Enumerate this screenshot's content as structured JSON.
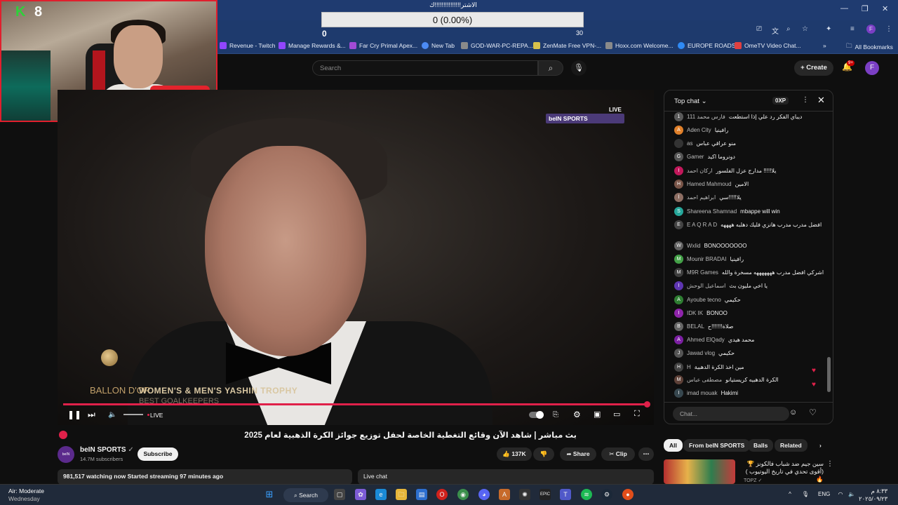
{
  "poll": {
    "title": "الاشتر!!!!!!!!!!!!!!!ك",
    "value": "0 (0.00%)",
    "min": "0",
    "max": "30"
  },
  "webcam": {
    "overlay": "8"
  },
  "bookmarks": [
    {
      "label": "Revenue - Twitch",
      "color": "#9146ff"
    },
    {
      "label": "Manage Rewards &...",
      "color": "#9146ff"
    },
    {
      "label": "Far Cry Primal Apex...",
      "color": "#a24bd6"
    },
    {
      "label": "New Tab",
      "color": "#4c8bf5"
    },
    {
      "label": "GOD-WAR-PC-REPA...",
      "color": "#8a8a8a"
    },
    {
      "label": "ZenMate Free VPN-...",
      "color": "#d6c04b"
    },
    {
      "label": "Hoxx.com Welcome...",
      "color": "#8a8a8a"
    },
    {
      "label": "EUROPE ROADS",
      "color": "#2f8af5"
    },
    {
      "label": "OmeTV Video Chat...",
      "color": "#e04040"
    }
  ],
  "all_bookmarks": "All Bookmarks",
  "youtube": {
    "search_placeholder": "Search",
    "create_label": "Create",
    "notif_badge": "9+",
    "avatar_letter": "F"
  },
  "player": {
    "channel_logo": "beIN SPORTS",
    "corner_live": "LIVE",
    "ballon_text": "BALLON D'OR",
    "trophy_line": "WOMEN'S & MEN'S YASHIN TROPHY",
    "trophy_sub": "BEST GOALKEEPERS",
    "live_label": "LIVE"
  },
  "video": {
    "title": "بث مباشر | شاهد الآن وقائع التغطية الخاصة لحفل توزيع جوائز الكرة الذهبية لعام 2025",
    "channel": "beIN SPORTS",
    "channel_avatar": "beIN",
    "subscribers": "14.7M subscribers",
    "subscribe_label": "Subscribe",
    "likes": "137K",
    "share_label": "Share",
    "clip_label": "Clip",
    "watching": "981,517 watching now  Started streaming 97 minutes ago",
    "live_chat_label": "Live chat"
  },
  "chat": {
    "title": "Top chat",
    "points": "0XP",
    "input_placeholder": "Chat...",
    "messages": [
      {
        "author": "111 فارس محمد",
        "text": "ديباي الفكر رد علي إذا استطعت",
        "color": "#5a5a5a",
        "initial": "1"
      },
      {
        "author": "Aden City",
        "text": "رافينيا",
        "color": "#e0802a",
        "initial": "A"
      },
      {
        "author": "as",
        "text": "منو عراقي عباس",
        "color": "#333",
        "initial": ""
      },
      {
        "author": "Gamer",
        "text": "دونروما اكيد",
        "color": "#555",
        "initial": "G"
      },
      {
        "author": "اركان احمد",
        "text": "يلا!!!!! مدارج عزل الفلسور",
        "color": "#c2185b",
        "initial": "I"
      },
      {
        "author": "Hamed Mahmoud",
        "text": "الامين",
        "color": "#795548",
        "initial": "H"
      },
      {
        "author": "ابراهيم احمد",
        "text": "يلا!!!!!سي",
        "color": "#8d6e63",
        "initial": "ا"
      },
      {
        "author": "Shareena Shamnad",
        "text": "mbappe will win",
        "color": "#26a69a",
        "initial": "S"
      },
      {
        "author": "E A Q R A D",
        "text": "افضل مدرب مدرب هانزي فليك دهلبه ههههه",
        "color": "#444",
        "initial": "E"
      },
      {
        "author": "Wxlid",
        "text": "BONOOOOOOO",
        "color": "#616161",
        "initial": "W"
      },
      {
        "author": "Mounir BRADAI",
        "text": "رافينيا",
        "color": "#43a047",
        "initial": "M"
      },
      {
        "author": "M9R Games",
        "text": "اشركي افضل مدرب هههههههه مسخرة والله",
        "color": "#3e3e3e",
        "initial": "M"
      },
      {
        "author": "اسماعيل الوحش",
        "text": "يا اخي مليون بث",
        "color": "#5e35b1",
        "initial": "I"
      },
      {
        "author": "Ayoube tecno",
        "text": "حكيمي",
        "color": "#2e7d32",
        "initial": "A"
      },
      {
        "author": "IDK IK",
        "text": "BONOO",
        "color": "#8e24aa",
        "initial": "I"
      },
      {
        "author": "BELAL",
        "text": "صلاة!!!!!!!ح",
        "color": "#666",
        "initial": "B"
      },
      {
        "author": "Ahmed ElQady",
        "text": "محمد هيدي",
        "color": "#7b1fa2",
        "initial": "A"
      },
      {
        "author": "Jawad vlog",
        "text": "حكيمي",
        "color": "#555",
        "initial": "J"
      },
      {
        "author": "H",
        "text": "مين اخذ الكرة الدهبية",
        "color": "#424242",
        "initial": "H"
      },
      {
        "author": "مصطفى عباس",
        "text": "الكرة الدهبيه كريستيانو",
        "color": "#5d4037",
        "initial": "M"
      },
      {
        "author": "imad mouak",
        "text": "Hakimi",
        "color": "#37474f",
        "initial": "I"
      }
    ]
  },
  "related": {
    "tabs": [
      "All",
      "From beIN SPORTS",
      "Balls",
      "Related"
    ],
    "title": "سين جيم ضد شباب فالكونز 🏆 (أقوى تحدي في تاريخ اليوتيوب ) 🔥",
    "channel": "TOPZ ✓"
  },
  "taskbar": {
    "weather_title": "Air: Moderate",
    "weather_sub": "Wednesday",
    "search_label": "Search",
    "lang": "ENG",
    "time": "٨:٣٣ م",
    "date": "٢٠٢٥/٠٩/٢٣"
  }
}
